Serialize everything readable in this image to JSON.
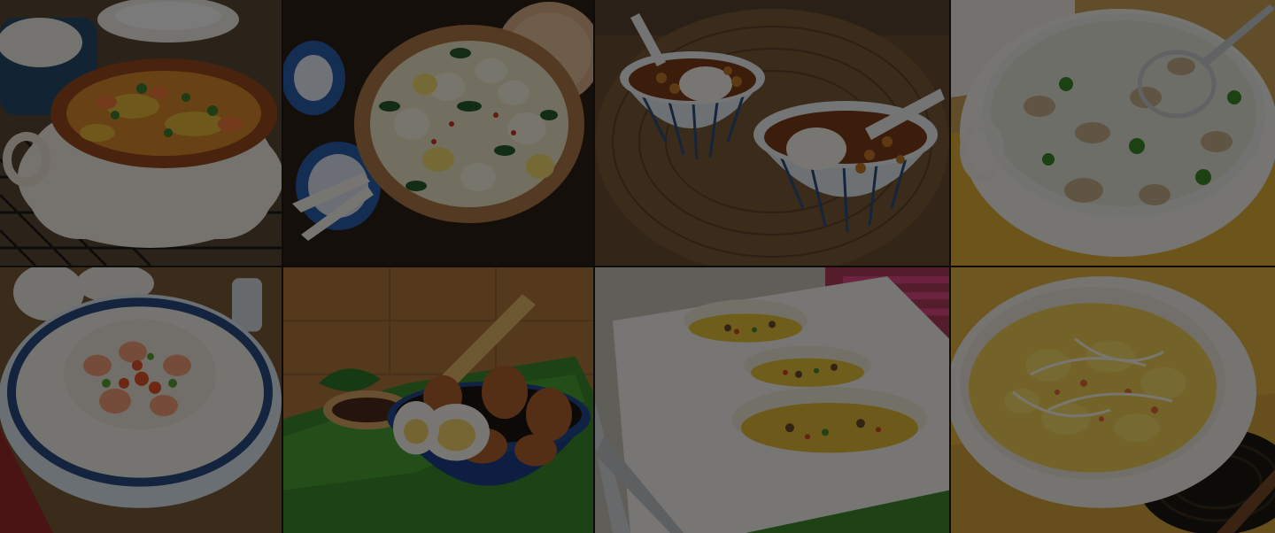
{
  "collage": {
    "overlay_color": "#000000",
    "tiles": [
      {
        "id": "tile-1",
        "subject": "rice-casserole"
      },
      {
        "id": "tile-2",
        "subject": "clay-pot-tofu-greens"
      },
      {
        "id": "tile-3",
        "subject": "sweet-soup-rice-balls"
      },
      {
        "id": "tile-4",
        "subject": "mushroom-congee-pot"
      },
      {
        "id": "tile-5",
        "subject": "seafood-congee-bowl"
      },
      {
        "id": "tile-6",
        "subject": "tea-eggs-bowl"
      },
      {
        "id": "tile-7",
        "subject": "egg-wraps-platter"
      },
      {
        "id": "tile-8",
        "subject": "scrambled-egg-sprouts"
      }
    ]
  }
}
